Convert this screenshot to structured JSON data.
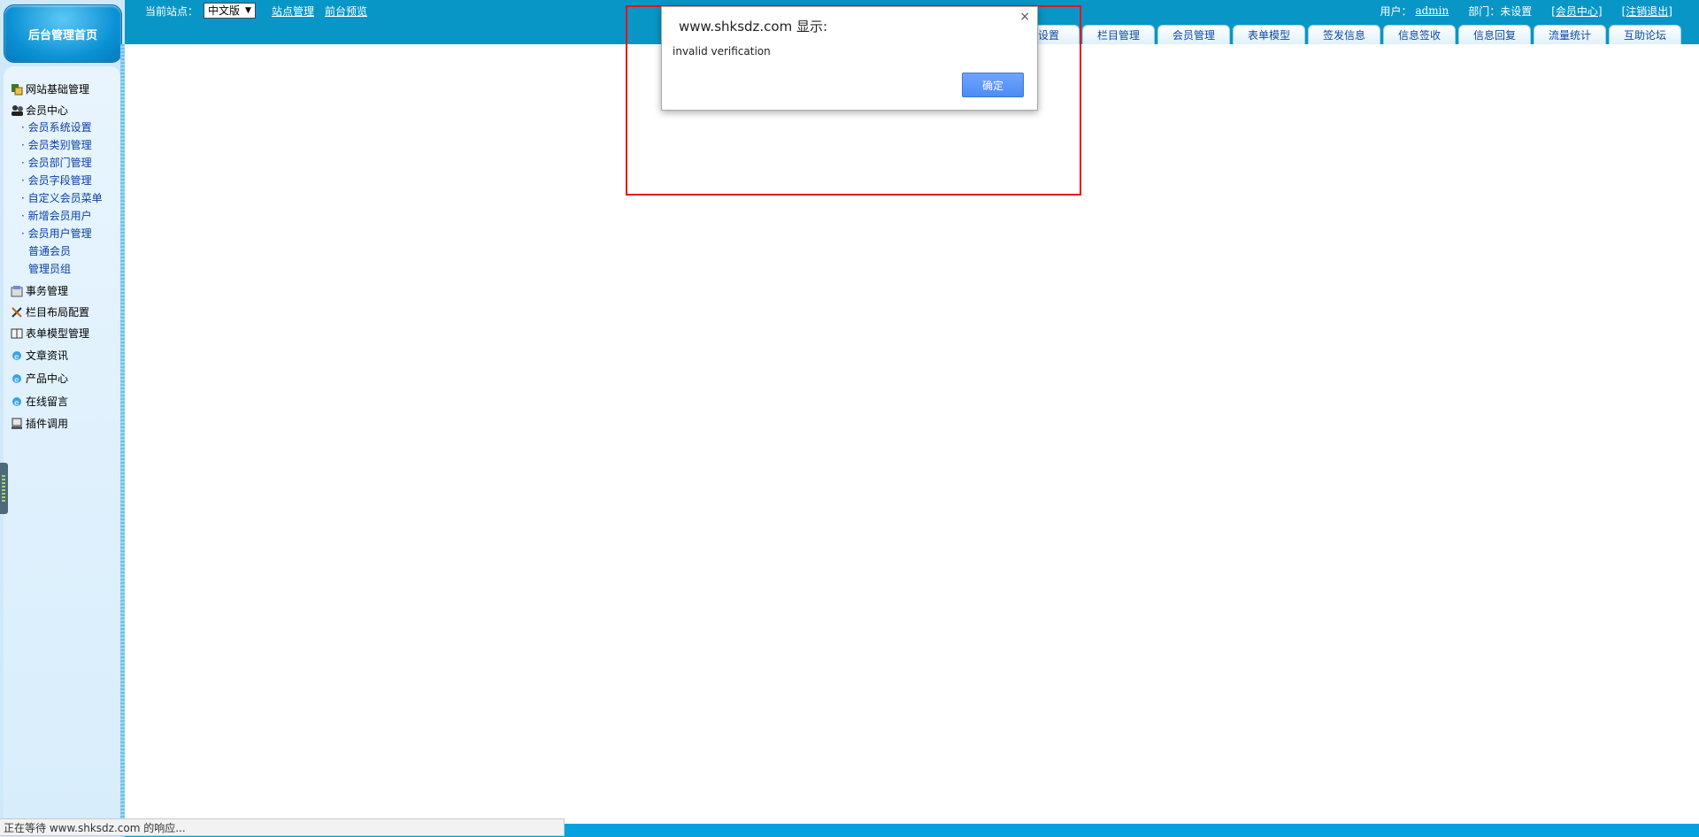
{
  "header": {
    "site_label": "当前站点：",
    "site_selected": "中文版",
    "links": [
      "站点管理",
      "前台预览"
    ],
    "user_label": "用户：",
    "user_name": "admin",
    "dept_label": "部门：未设置",
    "member_center": "[会员中心]",
    "logout": "[注销退出]"
  },
  "tabs": [
    "站设置",
    "栏目管理",
    "会员管理",
    "表单模型",
    "签发信息",
    "信息签收",
    "信息回复",
    "流量统计",
    "互助论坛"
  ],
  "sidebar": {
    "home_button": "后台管理首页",
    "groups": [
      {
        "label": "网站基础管理",
        "icon": "site-basic-icon"
      },
      {
        "label": "会员中心",
        "icon": "members-icon"
      }
    ],
    "member_items": [
      "会员系统设置",
      "会员类别管理",
      "会员部门管理",
      "会员字段管理",
      "自定义会员菜单",
      "新增会员用户",
      "会员用户管理"
    ],
    "member_sub_items": [
      "普通会员",
      "管理员组"
    ],
    "other_groups": [
      {
        "label": "事务管理",
        "icon": "affairs-icon"
      },
      {
        "label": "栏目布局配置",
        "icon": "layout-tools-icon"
      },
      {
        "label": "表单模型管理",
        "icon": "form-model-icon"
      },
      {
        "label": "文章资讯",
        "icon": "ie-globe-icon"
      },
      {
        "label": "产品中心",
        "icon": "ie-globe-icon"
      },
      {
        "label": "在线留言",
        "icon": "ie-globe-icon"
      },
      {
        "label": "插件调用",
        "icon": "computer-icon"
      }
    ]
  },
  "dialog": {
    "title": "www.shksdz.com 显示:",
    "message": "invalid verification",
    "ok_label": "确定",
    "close_glyph": "×"
  },
  "status": {
    "text": "正在等待 www.shksdz.com 的响应..."
  },
  "colors": {
    "topbar": "#0896c7",
    "tab_text": "#0b4aa6",
    "highlight": "#e8141b",
    "ok_button": "#4d8cf5"
  }
}
